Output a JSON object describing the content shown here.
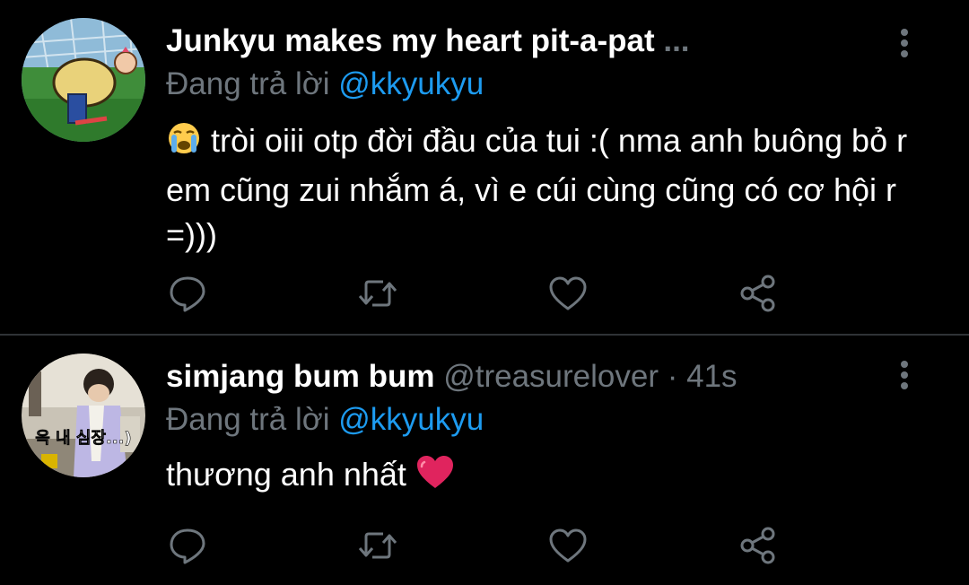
{
  "colors": {
    "background": "#000000",
    "text": "#ffffff",
    "muted": "#6e767d",
    "mention": "#1d9bf0",
    "divider": "#2f3336",
    "heart_emoji": "#e0245e"
  },
  "tweets": [
    {
      "display_name": "Junkyu makes my heart pit-a-pat",
      "name_ellipsis": "...",
      "replying_prefix": "Đang trả lời",
      "replying_to": "@kkyukyu",
      "text_emoji": "loudly-crying-face-emoji",
      "text": "tròi oiii otp đời đầu của tui :( nma anh buông bỏ r em cũng zui nhắm á, vì e cúi cùng cũng có cơ hội r =)))",
      "avatar": "cartoon-avatar",
      "actions": [
        "reply-icon",
        "retweet-icon",
        "like-icon",
        "share-icon"
      ]
    },
    {
      "display_name": "simjang bum bum",
      "handle": "@treasurelover",
      "separator": "·",
      "time": "41s",
      "replying_prefix": "Đang trả lời",
      "replying_to": "@kkyukyu",
      "text": "thương anh nhất",
      "text_emoji": "red-heart-emoji",
      "avatar": "photo-avatar",
      "avatar_caption": "윽 내 심장...)",
      "actions": [
        "reply-icon",
        "retweet-icon",
        "like-icon",
        "share-icon"
      ]
    }
  ]
}
